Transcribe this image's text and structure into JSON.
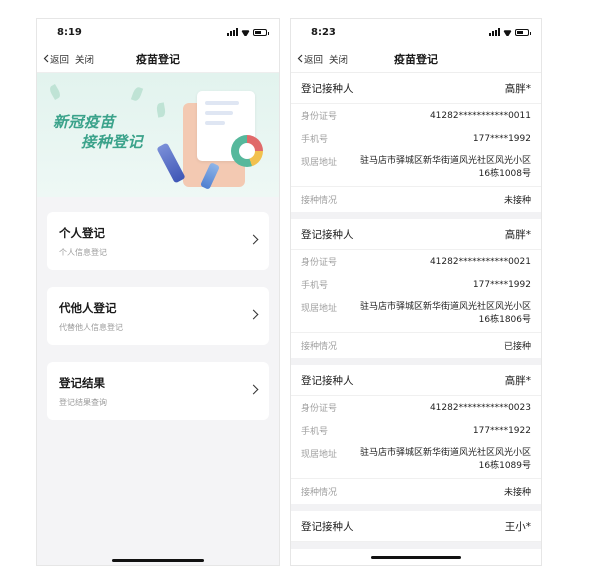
{
  "left": {
    "status_time": "8:19",
    "nav": {
      "back": "返回",
      "close": "关闭",
      "title": "疫苗登记"
    },
    "banner": {
      "line1": "新冠疫苗",
      "line2": "接种登记"
    },
    "menu": [
      {
        "title": "个人登记",
        "sub": "个人信息登记"
      },
      {
        "title": "代他人登记",
        "sub": "代替他人信息登记"
      },
      {
        "title": "登记结果",
        "sub": "登记结果查询"
      }
    ]
  },
  "right": {
    "status_time": "8:23",
    "nav": {
      "back": "返回",
      "close": "关闭",
      "title": "疫苗登记"
    },
    "labels": {
      "person": "登记接种人",
      "id": "身份证号",
      "phone": "手机号",
      "address": "现居地址",
      "status": "接种情况"
    },
    "records": [
      {
        "name": "高胖*",
        "id": "41282***********0011",
        "phone": "177****1992",
        "address": "驻马店市驿城区新华街道风光社区风光小区16栋1008号",
        "status": "未接种"
      },
      {
        "name": "高胖*",
        "id": "41282***********0021",
        "phone": "177****1992",
        "address": "驻马店市驿城区新华街道风光社区风光小区16栋1806号",
        "status": "已接种"
      },
      {
        "name": "高胖*",
        "id": "41282***********0023",
        "phone": "177****1922",
        "address": "驻马店市驿城区新华街道风光社区风光小区16栋1089号",
        "status": "未接种"
      }
    ],
    "partial_record": {
      "name": "王小*"
    }
  }
}
